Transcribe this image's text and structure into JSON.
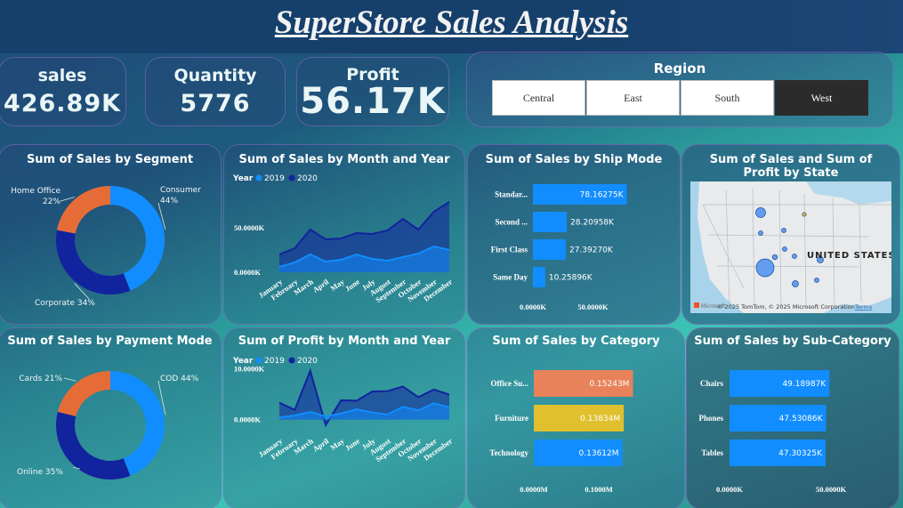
{
  "title": "SuperStore Sales Analysis",
  "kpis": [
    {
      "label": "sales",
      "value": "426.89K"
    },
    {
      "label": "Quantity",
      "value": "5776"
    },
    {
      "label": "Profit",
      "value": "56.17K"
    }
  ],
  "region": {
    "title": "Region",
    "options": [
      "Central",
      "East",
      "South",
      "West"
    ],
    "selected": "West"
  },
  "colors": {
    "series_2019": "#118DFF",
    "series_2020": "#12239E",
    "orange": "#E66C37",
    "bar_blue": "#118DFF",
    "category_orange": "#E8825A",
    "category_yellow": "#E0C02E"
  },
  "panels": {
    "segment": "Sum of Sales by Segment",
    "month_sales": "Sum of Sales by Month and Year",
    "ship_mode": "Sum of Sales by Ship Mode",
    "state": "Sum of Sales and Sum of Profit by State",
    "payment": "Sum of Sales by Payment Mode",
    "month_profit": "Sum of Profit by Month and Year",
    "category": "Sum of Sales by Category",
    "subcategory": "Sum of Sales by Sub-Category"
  },
  "map": {
    "country_label": "UNITED STATES",
    "attribution": "© 2025 TomTom, © 2025 Microsoft Corporation",
    "terms": "Terms",
    "logo_text": "Microsoft"
  },
  "chart_data": [
    {
      "id": "segment",
      "type": "pie",
      "title": "Sum of Sales by Segment",
      "slices": [
        {
          "name": "Consumer",
          "value": 44,
          "label": "Consumer\n44%",
          "color": "#118DFF"
        },
        {
          "name": "Corporate",
          "value": 34,
          "label": "Corporate 34%",
          "color": "#12239E"
        },
        {
          "name": "Home Office",
          "value": 22,
          "label": "Home Office\n22%",
          "color": "#E66C37"
        }
      ]
    },
    {
      "id": "month_sales",
      "type": "area",
      "title": "Sum of Sales by Month and Year",
      "legend_title": "Year",
      "categories": [
        "January",
        "February",
        "March",
        "April",
        "May",
        "June",
        "July",
        "August",
        "September",
        "October",
        "November",
        "December"
      ],
      "series": [
        {
          "name": "2019",
          "values": [
            6,
            11,
            20,
            12,
            14,
            20,
            15,
            13,
            17,
            21,
            29,
            25
          ]
        },
        {
          "name": "2020",
          "values": [
            20,
            27,
            48,
            37,
            38,
            44,
            43,
            47,
            60,
            48,
            68,
            79
          ]
        }
      ],
      "y_ticks": [
        "0.0000K",
        "50.0000K"
      ],
      "ylim": [
        0,
        105
      ]
    },
    {
      "id": "ship_mode",
      "type": "bar",
      "orientation": "horizontal",
      "title": "Sum of Sales by Ship Mode",
      "categories": [
        "Standar...",
        "Second ...",
        "First Class",
        "Same Day"
      ],
      "values": [
        78.16275,
        28.20958,
        27.3927,
        10.25896
      ],
      "labels": [
        "78.16275K",
        "28.20958K",
        "27.39270K",
        "10.25896K"
      ],
      "x_ticks": [
        "0.0000K",
        "50.0000K"
      ],
      "xlim": [
        0,
        100
      ]
    },
    {
      "id": "payment",
      "type": "pie",
      "title": "Sum of Sales by Payment Mode",
      "slices": [
        {
          "name": "COD",
          "value": 44,
          "label": "COD 44%",
          "color": "#118DFF"
        },
        {
          "name": "Online",
          "value": 35,
          "label": "Online 35%",
          "color": "#12239E"
        },
        {
          "name": "Cards",
          "value": 21,
          "label": "Cards 21%",
          "color": "#E66C37"
        }
      ]
    },
    {
      "id": "month_profit",
      "type": "area",
      "title": "Sum of Profit by Month and Year",
      "legend_title": "Year",
      "categories": [
        "January",
        "February",
        "March",
        "April",
        "May",
        "June",
        "July",
        "August",
        "September",
        "October",
        "November",
        "December"
      ],
      "series": [
        {
          "name": "2019",
          "values": [
            0.4,
            0.8,
            1.5,
            0.6,
            1.2,
            2.0,
            1.4,
            1.0,
            2.5,
            1.8,
            3.2,
            2.4
          ]
        },
        {
          "name": "2020",
          "values": [
            3.3,
            1.9,
            9.6,
            -1.1,
            3.8,
            3.7,
            5.5,
            5.6,
            6.5,
            4.4,
            5.9,
            4.9
          ]
        }
      ],
      "y_ticks": [
        "0.0000K",
        "10.0000K"
      ],
      "ylim": [
        -2,
        12
      ]
    },
    {
      "id": "category",
      "type": "bar",
      "orientation": "horizontal",
      "title": "Sum of Sales by Category",
      "categories": [
        "Office Su...",
        "Furniture",
        "Technology"
      ],
      "values": [
        0.15243,
        0.13834,
        0.13612
      ],
      "labels": [
        "0.15243M",
        "0.13834M",
        "0.13612M"
      ],
      "bar_colors": [
        "#E8825A",
        "#E0C02E",
        "#118DFF"
      ],
      "x_ticks": [
        "0.0000M",
        "0.1000M"
      ],
      "xlim": [
        0,
        0.16
      ]
    },
    {
      "id": "subcategory",
      "type": "bar",
      "orientation": "horizontal",
      "title": "Sum of Sales by Sub-Category",
      "categories": [
        "Chairs",
        "Phones",
        "Tables"
      ],
      "values": [
        49.18987,
        47.53086,
        47.30325
      ],
      "labels": [
        "49.18987K",
        "47.53086K",
        "47.30325K"
      ],
      "x_ticks": [
        "0.0000K",
        "50.0000K"
      ],
      "xlim": [
        0,
        60
      ]
    }
  ]
}
